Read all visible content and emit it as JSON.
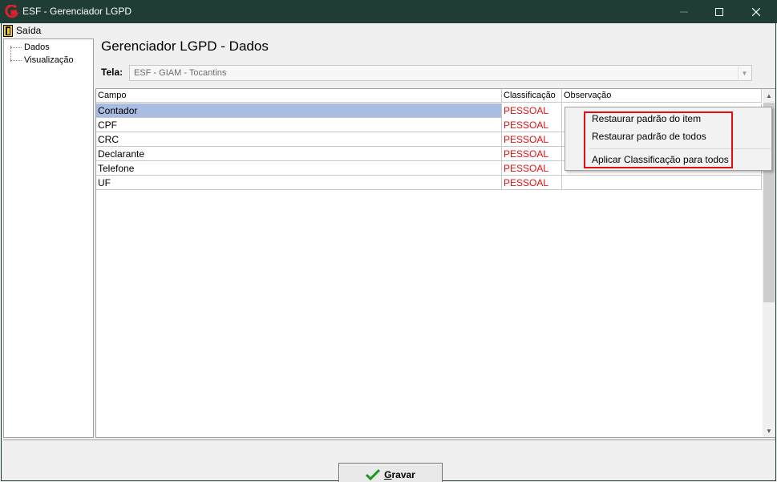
{
  "window": {
    "title": "ESF - Gerenciador LGPD",
    "minimize_icon": "minimize-icon",
    "maximize_icon": "maximize-icon",
    "close_icon": "close-icon"
  },
  "menu": {
    "exit_label": "Saída"
  },
  "tree": {
    "items": [
      {
        "label": "Dados"
      },
      {
        "label": "Visualização"
      }
    ]
  },
  "panel": {
    "title": "Gerenciador LGPD - Dados",
    "tela_label": "Tela:",
    "tela_value": "ESF - GIAM - Tocantins"
  },
  "grid": {
    "headers": {
      "campo": "Campo",
      "classificacao": "Classificação",
      "observacao": "Observação"
    },
    "rows": [
      {
        "campo": "Contador",
        "classificacao": "PESSOAL",
        "observacao": ""
      },
      {
        "campo": "CPF",
        "classificacao": "PESSOAL",
        "observacao": ""
      },
      {
        "campo": "CRC",
        "classificacao": "PESSOAL",
        "observacao": ""
      },
      {
        "campo": "Declarante",
        "classificacao": "PESSOAL",
        "observacao": ""
      },
      {
        "campo": "Telefone",
        "classificacao": "PESSOAL",
        "observacao": ""
      },
      {
        "campo": "UF",
        "classificacao": "PESSOAL",
        "observacao": ""
      }
    ],
    "selected_row": 0
  },
  "context_menu": {
    "items": [
      {
        "label": "Restaurar padrão do item"
      },
      {
        "label": "Restaurar padrão de todos"
      },
      {
        "label": "Aplicar Classificação para todos"
      }
    ]
  },
  "footer": {
    "save_label_first": "G",
    "save_label_rest": "ravar"
  },
  "colors": {
    "titlebar": "#1f3d34",
    "classification_text": "#e01010",
    "selected_row": "#a9bde3",
    "highlight": "#e01010"
  }
}
